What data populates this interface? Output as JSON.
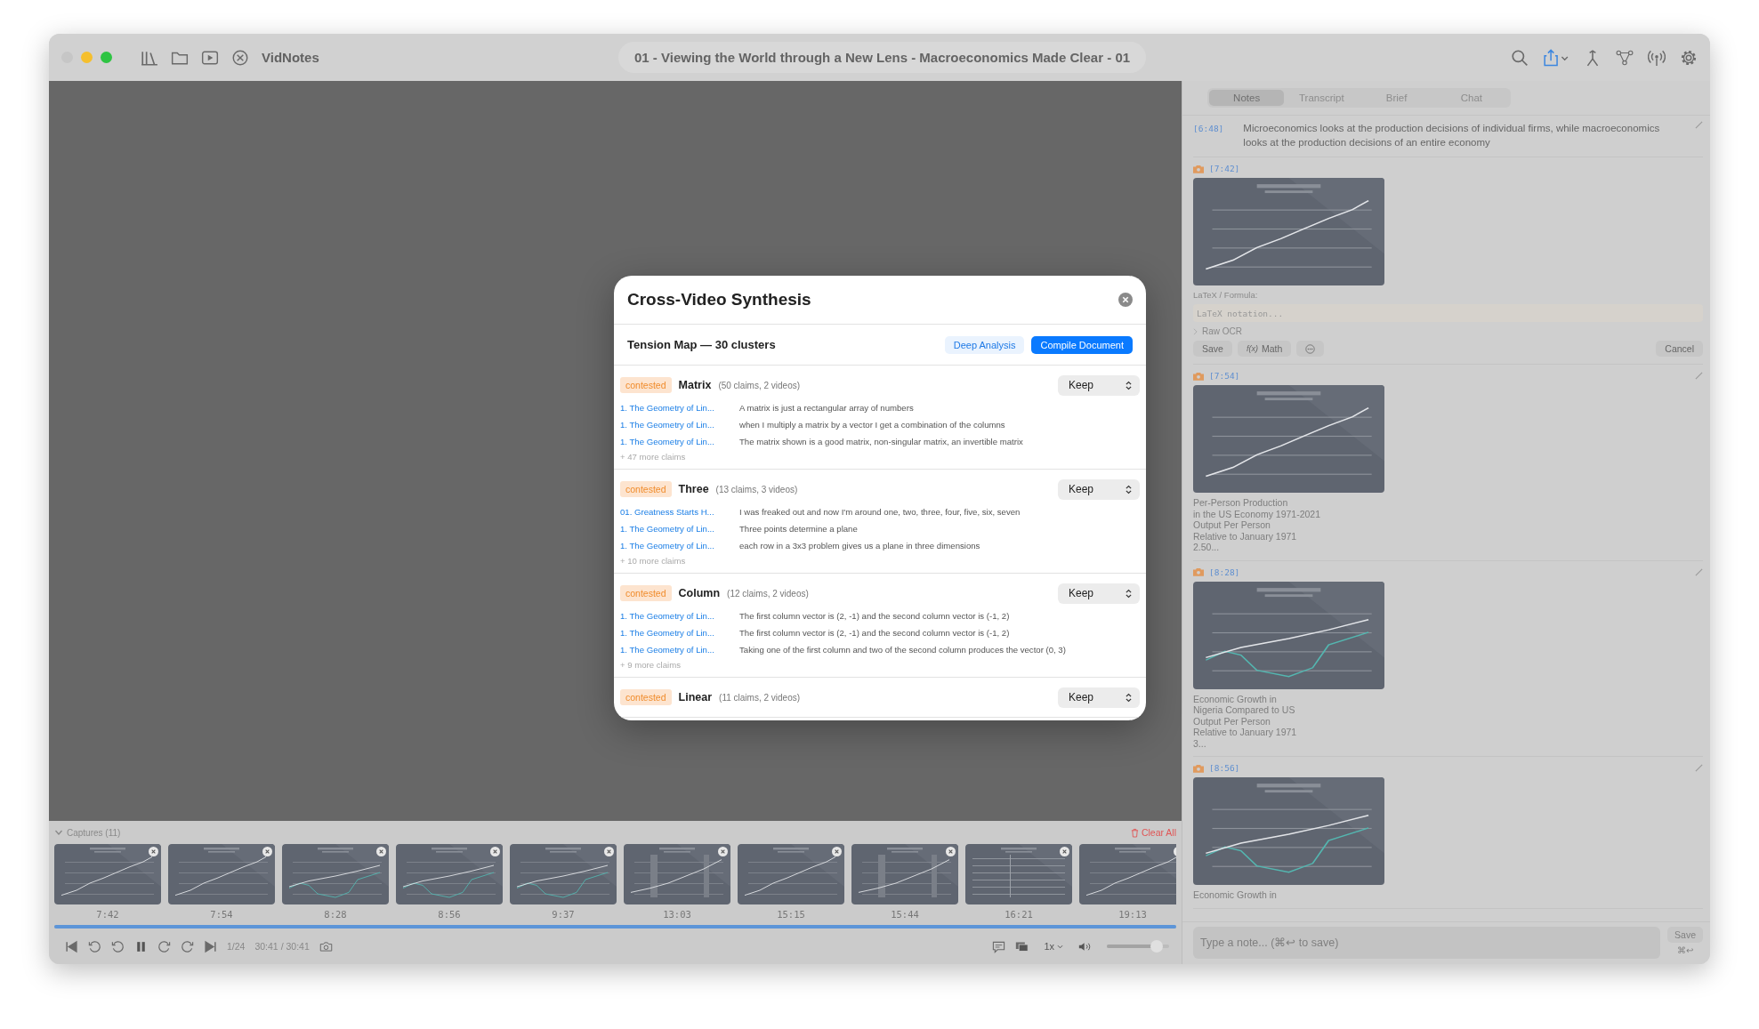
{
  "window": {
    "app_name": "VidNotes",
    "title": "01 - Viewing the World through a New Lens - Macroeconomics Made Clear - 01"
  },
  "tabs": [
    {
      "label": "Notes",
      "selected": true
    },
    {
      "label": "Transcript",
      "selected": false
    },
    {
      "label": "Brief",
      "selected": false
    },
    {
      "label": "Chat",
      "selected": false
    }
  ],
  "notes": [
    {
      "kind": "text",
      "time": "[6:48]",
      "text": "Microeconomics looks at the production decisions of individual firms, while macroeconomics looks at the production decisions of an entire economy"
    },
    {
      "kind": "capture",
      "time": "[7:42]",
      "editor": {
        "label": "LaTeX / Formula:",
        "placeholder": "LaTeX notation...",
        "raw_ocr": {
          "label": "Raw OCR",
          "expanded": false
        },
        "save": "Save",
        "math_icon": "f(x)",
        "math": "Math",
        "cancel": "Cancel"
      }
    },
    {
      "kind": "capture",
      "time": "[7:54]",
      "caption": "Per-Person Production\nin the US Economy 1971-2021\nOutput Per Person\nRelative to January 1971\n2.50..."
    },
    {
      "kind": "capture",
      "time": "[8:28]",
      "caption": "Economic Growth in\nNigeria Compared to US\nOutput Per Person\nRelative to January 1971\n3..."
    },
    {
      "kind": "capture",
      "time": "[8:56]",
      "caption": "Economic Growth in"
    }
  ],
  "composer": {
    "placeholder": "Type a note... (⌘↩ to save)",
    "save": "Save",
    "shortcut": "⌘↩"
  },
  "captures": {
    "label": "Captures (11)",
    "expanded": true,
    "clear": "Clear All",
    "items": [
      {
        "time": "7:42"
      },
      {
        "time": "7:54"
      },
      {
        "time": "8:28"
      },
      {
        "time": "8:56"
      },
      {
        "time": "9:37"
      },
      {
        "time": "13:03"
      },
      {
        "time": "15:15"
      },
      {
        "time": "15:44"
      },
      {
        "time": "16:21"
      },
      {
        "time": "19:13"
      }
    ]
  },
  "player": {
    "position": "1/24",
    "time": "30:41 / 30:41",
    "speed": "1x",
    "playing": true,
    "progress": {
      "level": 1.0
    },
    "volume": {
      "level": 0.88
    }
  },
  "modal": {
    "title": "Cross-Video Synthesis",
    "subtitle": "Tension Map — 30 clusters",
    "buttons": [
      "Deep Analysis",
      "Compile Document"
    ],
    "clusters": [
      {
        "tag": "contested",
        "name": "Matrix",
        "meta": "(50 claims, 2 videos)",
        "action": "Keep",
        "claims": [
          {
            "source": "1. The Geometry of Lin...",
            "text": "A matrix is just a rectangular array of numbers"
          },
          {
            "source": "1. The Geometry of Lin...",
            "text": "when I multiply a matrix by a vector I get a combination of the columns"
          },
          {
            "source": "1. The Geometry of Lin...",
            "text": "The matrix shown is a good matrix, non-singular matrix, an invertible matrix"
          }
        ],
        "more": "+ 47 more claims"
      },
      {
        "tag": "contested",
        "name": "Three",
        "meta": "(13 claims, 3 videos)",
        "action": "Keep",
        "claims": [
          {
            "source": "01. Greatness Starts H...",
            "text": "I was freaked out and now I'm around one, two, three, four, five, six, seven"
          },
          {
            "source": "1. The Geometry of Lin...",
            "text": "Three points determine a plane"
          },
          {
            "source": "1. The Geometry of Lin...",
            "text": "each row in a 3x3 problem gives us a plane in three dimensions"
          }
        ],
        "more": "+ 10 more claims"
      },
      {
        "tag": "contested",
        "name": "Column",
        "meta": "(12 claims, 2 videos)",
        "action": "Keep",
        "claims": [
          {
            "source": "1. The Geometry of Lin...",
            "text": "The first column vector is (2, -1) and the second column vector is (-1, 2)"
          },
          {
            "source": "1. The Geometry of Lin...",
            "text": "The first column vector is (2, -1) and the second column vector is (-1, 2)"
          },
          {
            "source": "1. The Geometry of Lin...",
            "text": "Taking one of the first column and two of the second column produces the vector (0, 3)"
          }
        ],
        "more": "+ 9 more claims"
      },
      {
        "tag": "contested",
        "name": "Linear",
        "meta": "(11 claims, 2 videos)",
        "action": "Keep"
      }
    ]
  }
}
